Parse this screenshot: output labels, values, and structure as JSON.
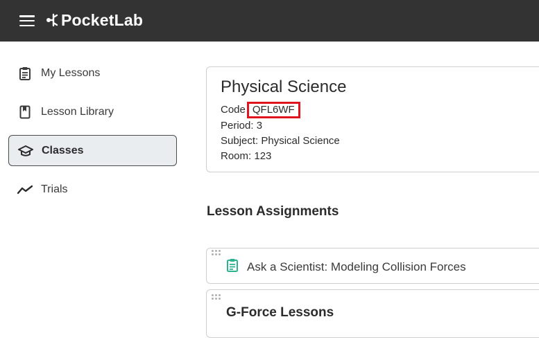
{
  "app": {
    "name": "PocketLab"
  },
  "sidebar": {
    "items": [
      {
        "label": "My Lessons",
        "icon": "clipboard-icon"
      },
      {
        "label": "Lesson Library",
        "icon": "book-icon"
      },
      {
        "label": "Classes",
        "icon": "graduation-cap-icon",
        "active": true
      },
      {
        "label": "Trials",
        "icon": "trend-line-icon"
      }
    ]
  },
  "class_info": {
    "title": "Physical Science",
    "code_label": "Code",
    "code": "QFL6WF",
    "period": "Period: 3",
    "subject": "Subject: Physical Science",
    "room": "Room: 123"
  },
  "assignments": {
    "title": "Lesson Assignments",
    "items": [
      {
        "label": "Ask a Scientist: Modeling Collision Forces",
        "icon": "clipboard-icon"
      },
      {
        "label": "G-Force Lessons"
      }
    ]
  },
  "colors": {
    "topbar": "#333333",
    "highlight": "#e0141e",
    "assignment_icon": "#2bb38f"
  }
}
